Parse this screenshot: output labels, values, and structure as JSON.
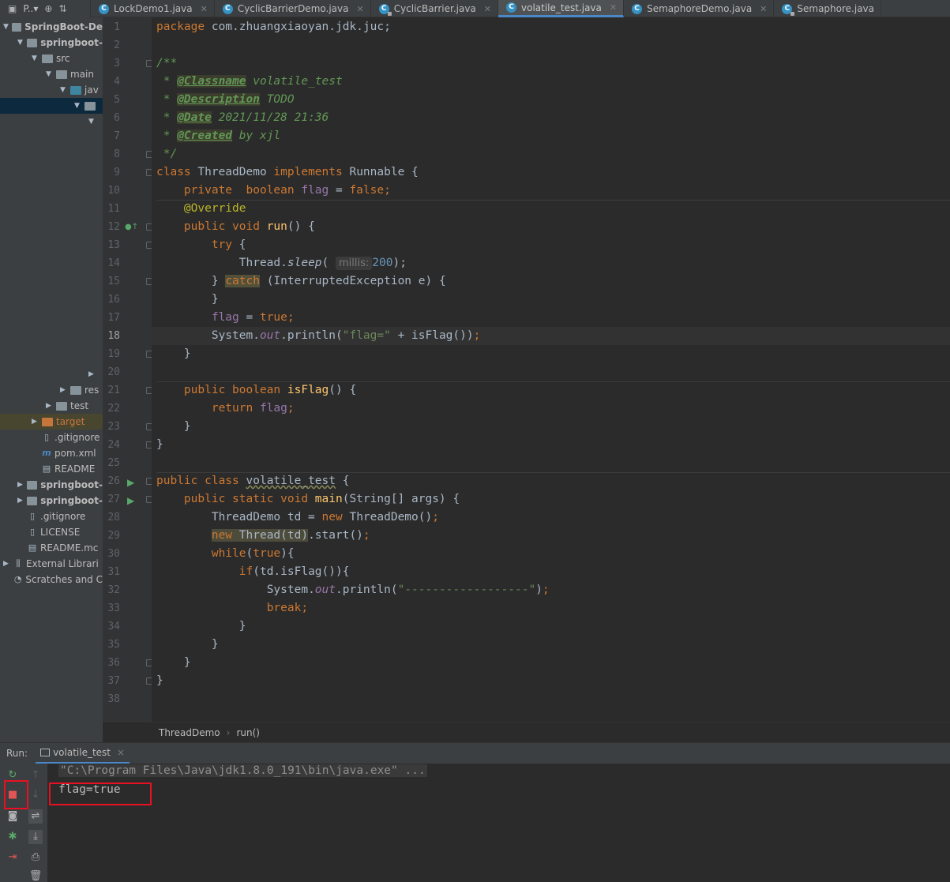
{
  "toolbar": {
    "project_label": "P..▾"
  },
  "tabs": [
    {
      "label": "LockDemo1.java",
      "active": false
    },
    {
      "label": "CyclicBarrierDemo.java",
      "active": false
    },
    {
      "label": "CyclicBarrier.java",
      "active": false,
      "locked": true
    },
    {
      "label": "volatile_test.java",
      "active": true
    },
    {
      "label": "SemaphoreDemo.java",
      "active": false
    },
    {
      "label": "Semaphore.java",
      "active": false,
      "locked": true
    }
  ],
  "tree": [
    {
      "label": "SpringBoot-De",
      "bold": true
    },
    {
      "label": "springboot-",
      "bold": true
    },
    {
      "label": "src"
    },
    {
      "label": "main"
    },
    {
      "label": "jav"
    },
    {
      "label": ""
    },
    {
      "label": ""
    },
    {
      "label": ""
    },
    {
      "label": "res"
    },
    {
      "label": "test"
    },
    {
      "label": "target"
    },
    {
      "label": ".gitignore"
    },
    {
      "label": "pom.xml"
    },
    {
      "label": "README"
    },
    {
      "label": "springboot-",
      "bold": true
    },
    {
      "label": "springboot-",
      "bold": true
    },
    {
      "label": ".gitignore"
    },
    {
      "label": "LICENSE"
    },
    {
      "label": "README.mc"
    },
    {
      "label": "External Librari"
    },
    {
      "label": "Scratches and C"
    }
  ],
  "editor": {
    "line_numbers": [
      "1",
      "2",
      "3",
      "4",
      "5",
      "6",
      "7",
      "8",
      "9",
      "10",
      "11",
      "12",
      "13",
      "14",
      "15",
      "16",
      "17",
      "18",
      "19",
      "20",
      "21",
      "22",
      "23",
      "24",
      "25",
      "26",
      "27",
      "28",
      "29",
      "30",
      "31",
      "32",
      "33",
      "34",
      "35",
      "36",
      "37",
      "38"
    ],
    "current_line": 18,
    "code": {
      "l1_kw": "package",
      "l1_rest": " com.zhuangxiaoyan.jdk.juc;",
      "l3": "/**",
      "l4_pre": " * ",
      "l4_tag": "@Classname",
      "l4_rest": " volatile_test",
      "l5_pre": " * ",
      "l5_tag": "@Description",
      "l5_rest": " TODO",
      "l6_pre": " * ",
      "l6_tag": "@Date",
      "l6_rest": " 2021/11/28 21:36",
      "l7_pre": " * ",
      "l7_tag": "@Created",
      "l7_rest": " by xjl",
      "l8": " */",
      "l9_kw1": "class",
      "l9_name": " ThreadDemo ",
      "l9_kw2": "implements",
      "l9_rest": " Runnable {",
      "l10_indent": "    ",
      "l10_kw": "private  boolean ",
      "l10_fld": "flag",
      "l10_eq": " = ",
      "l10_kw2": "false",
      "l10_end": ";",
      "l11_indent": "    ",
      "l11_ann": "@Override",
      "l12_indent": "    ",
      "l12_kw": "public void ",
      "l12_mth": "run",
      "l12_rest": "() {",
      "l13_indent": "        ",
      "l13_kw": "try",
      "l13_rest": " {",
      "l14_indent": "            ",
      "l14_cls": "Thread.",
      "l14_mth": "sleep",
      "l14_open": "( ",
      "l14_hint": "millis:",
      "l14_num": "200",
      "l14_end": ");",
      "l15_indent": "        ",
      "l15_a": "} ",
      "l15_kw": "catch",
      "l15_rest": " (InterruptedException e) {",
      "l16": "        }",
      "l17_indent": "        ",
      "l17_fld": "flag",
      "l17_eq": " = ",
      "l17_kw": "true",
      "l17_end": ";",
      "l18_indent": "        ",
      "l18_a": "System.",
      "l18_out": "out",
      "l18_b": ".println(",
      "l18_str": "\"flag=\"",
      "l18_c": " + isFlag())",
      "l18_end": ";",
      "l19": "    }",
      "l21_indent": "    ",
      "l21_kw": "public boolean ",
      "l21_mth": "isFlag",
      "l21_rest": "() {",
      "l22_indent": "        ",
      "l22_kw": "return ",
      "l22_fld": "flag",
      "l22_end": ";",
      "l23": "    }",
      "l24": "}",
      "l26_kw": "public class ",
      "l26_name": "volatile_test",
      "l26_rest": " {",
      "l27_indent": "    ",
      "l27_kw": "public static void ",
      "l27_mth": "main",
      "l27_rest": "(String[] args) {",
      "l28_indent": "        ",
      "l28_a": "ThreadDemo td = ",
      "l28_kw": "new",
      "l28_rest": " ThreadDemo()",
      "l28_end": ";",
      "l29_indent": "        ",
      "l29_kw": "new",
      "l29_hl": " Thread(td)",
      "l29_rest": ".start()",
      "l29_end": ";",
      "l30_indent": "        ",
      "l30_kw": "while",
      "l30_a": "(",
      "l30_kw2": "true",
      "l30_rest": "){",
      "l31_indent": "            ",
      "l31_kw": "if",
      "l31_rest": "(td.isFlag()){",
      "l32_indent": "                ",
      "l32_a": "System.",
      "l32_out": "out",
      "l32_b": ".println(",
      "l32_str": "\"------------------\"",
      "l32_c": ")",
      "l32_end": ";",
      "l33_indent": "                ",
      "l33_kw": "break",
      "l33_end": ";",
      "l34": "            }",
      "l35": "        }",
      "l36": "    }",
      "l37": "}"
    }
  },
  "breadcrumb": {
    "class": "ThreadDemo",
    "method": "run()",
    "separator": "›"
  },
  "run_panel": {
    "label": "Run:",
    "tab": "volatile_test",
    "tab_close": "×",
    "console": [
      "\"C:\\Program Files\\Java\\jdk1.8.0_191\\bin\\java.exe\" ...",
      "flag=true"
    ]
  },
  "colors": {
    "keyword": "#cc7832",
    "comment": "#629755",
    "string": "#6a8759",
    "number": "#6897bb",
    "field": "#9876aa",
    "annotation": "#bbb529",
    "accent": "#4a88c7",
    "highlight_box": "#e81123"
  }
}
